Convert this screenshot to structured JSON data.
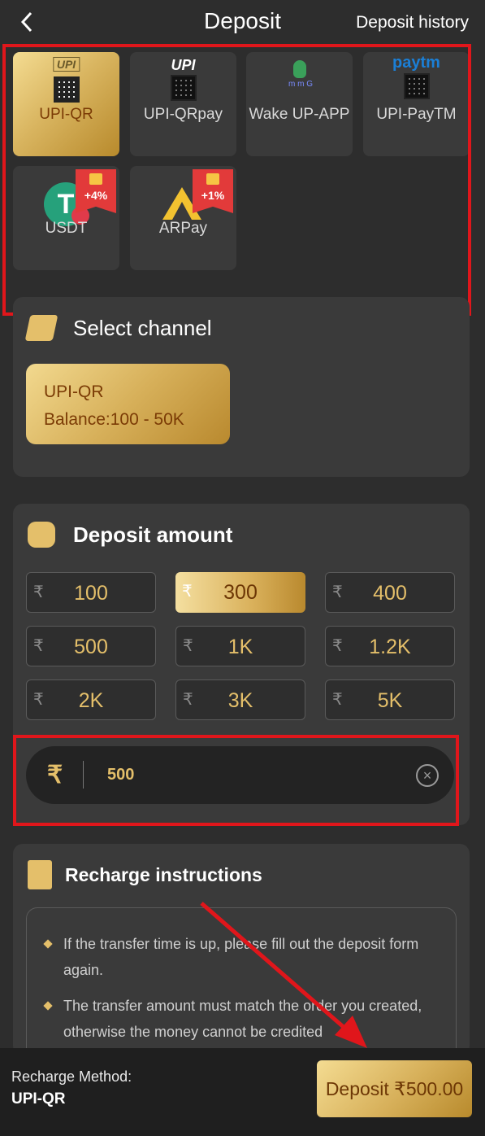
{
  "header": {
    "title": "Deposit",
    "history_label": "Deposit history"
  },
  "methods": [
    {
      "label": "UPI-QR",
      "active": true,
      "icon": "upi-qr-icon"
    },
    {
      "label": "UPI-QRpay",
      "active": false,
      "icon": "upi-qrpay-icon"
    },
    {
      "label": "Wake UP-APP",
      "active": false,
      "icon": "wake-up-app-icon"
    },
    {
      "label": "UPI-PayTM",
      "active": false,
      "icon": "paytm-icon"
    },
    {
      "label": "USDT",
      "active": false,
      "icon": "usdt-icon",
      "badge": "+4%"
    },
    {
      "label": "ARPay",
      "active": false,
      "icon": "arpay-icon",
      "badge": "+1%"
    }
  ],
  "logos": {
    "upi": "UPI",
    "paytm": "paytm",
    "wake": "m m G"
  },
  "channel": {
    "title": "Select channel",
    "name": "UPI-QR",
    "balance": "Balance:100 - 50K"
  },
  "amount": {
    "title": "Deposit amount",
    "currency": "₹",
    "options": [
      "100",
      "300",
      "400",
      "500",
      "1K",
      "1.2K",
      "2K",
      "3K",
      "5K"
    ],
    "selected": "300",
    "input_value": "500"
  },
  "instructions": {
    "title": "Recharge instructions",
    "items": [
      "If the transfer time is up, please fill out the deposit form again.",
      "The transfer amount must match the order you created, otherwise the money cannot be credited"
    ]
  },
  "footer": {
    "method_label": "Recharge Method:",
    "method_value": "UPI-QR",
    "deposit_button": "Deposit ₹500.00"
  },
  "colors": {
    "gold": "#e4bf6a",
    "accent_red": "#e0161b",
    "background": "#2d2d2d"
  }
}
